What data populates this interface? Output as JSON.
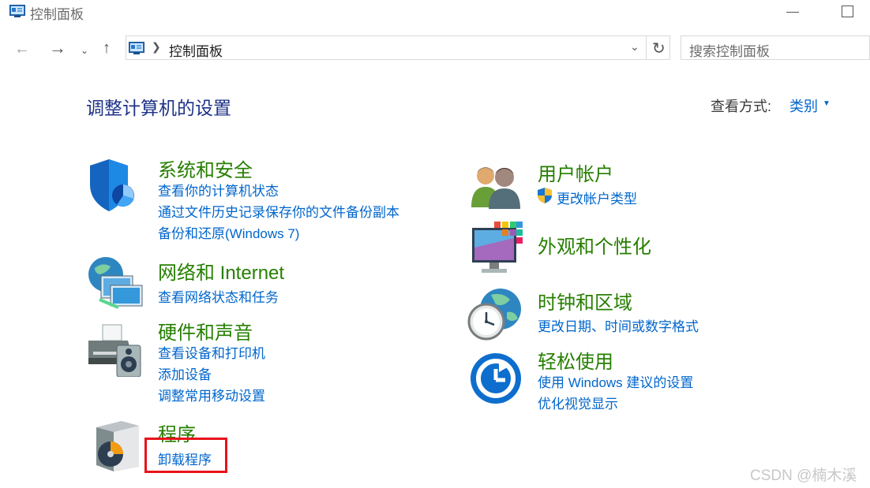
{
  "window": {
    "title": "控制面板"
  },
  "address": {
    "breadcrumb": "控制面板",
    "search_placeholder": "搜索控制面板"
  },
  "heading": {
    "title": "调整计算机的设置",
    "view_by_label": "查看方式:",
    "view_by_value": "类别"
  },
  "categories": {
    "system_security": {
      "title": "系统和安全",
      "links": [
        "查看你的计算机状态",
        "通过文件历史记录保存你的文件备份副本",
        "备份和还原(Windows 7)"
      ]
    },
    "network": {
      "title": "网络和 Internet",
      "links": [
        "查看网络状态和任务"
      ]
    },
    "hardware": {
      "title": "硬件和声音",
      "links": [
        "查看设备和打印机",
        "添加设备",
        "调整常用移动设置"
      ]
    },
    "programs": {
      "title": "程序",
      "links": [
        "卸载程序"
      ]
    },
    "user_accounts": {
      "title": "用户帐户",
      "links": [
        "更改帐户类型"
      ]
    },
    "appearance": {
      "title": "外观和个性化",
      "links": []
    },
    "clock_region": {
      "title": "时钟和区域",
      "links": [
        "更改日期、时间或数字格式"
      ]
    },
    "ease_of_access": {
      "title": "轻松使用",
      "links": [
        "使用 Windows 建议的设置",
        "优化视觉显示"
      ]
    }
  },
  "icons": {
    "title_icon": "control-panel-icon",
    "system_security": "shield-pie-icon",
    "network": "globe-monitors-icon",
    "hardware": "printer-speaker-icon",
    "programs": "software-box-disc-icon",
    "user_accounts": "users-icon",
    "appearance": "monitor-palette-icon",
    "clock_region": "clock-globe-icon",
    "ease_of_access": "ease-of-access-icon",
    "uac_shield": "uac-shield-icon"
  },
  "colors": {
    "heading_blue": "#1e3287",
    "category_green": "#267f00",
    "link_blue": "#0066cc",
    "annotation_red": "#e8121b"
  },
  "watermark": "CSDN @楠木溪"
}
